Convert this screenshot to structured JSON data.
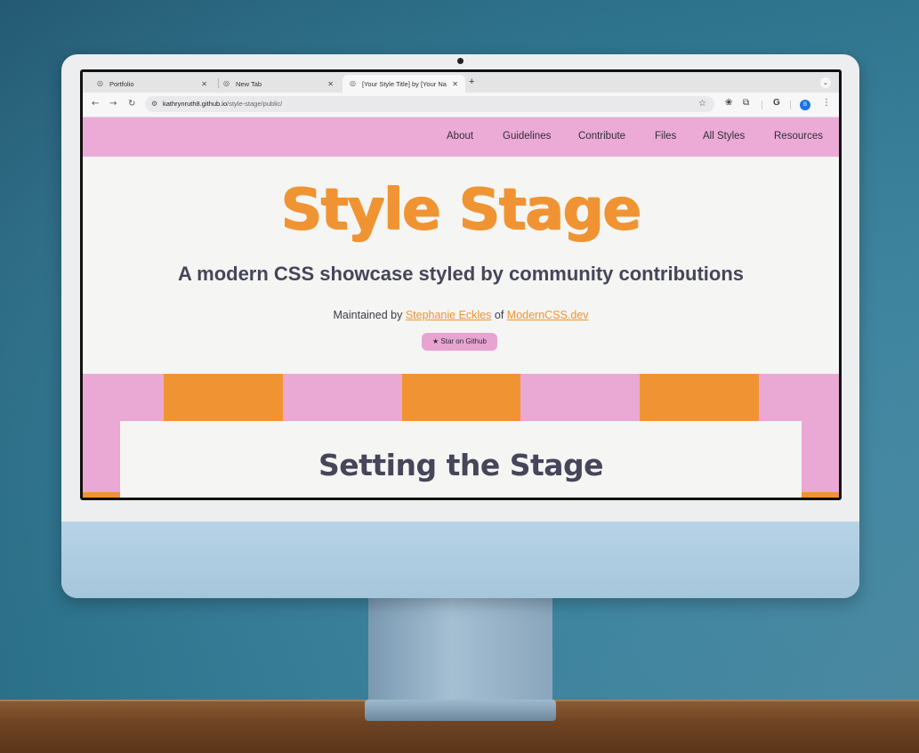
{
  "browser": {
    "tabs": [
      {
        "label": "Portfolio",
        "close": "✕"
      },
      {
        "label": "New Tab",
        "close": "✕"
      },
      {
        "label": "[Your Style Title] by [Your Na",
        "close": "✕"
      }
    ],
    "new_tab": "+",
    "tab_menu": "⌄",
    "nav": {
      "back": "←",
      "forward": "→",
      "reload": "↻"
    },
    "url_host": "kathrynruth8.github.io",
    "url_path": "/style-stage/public/",
    "star": "☆",
    "avatar_initial": "B",
    "google": "G",
    "menu": "⋮"
  },
  "site": {
    "nav": [
      "About",
      "Guidelines",
      "Contribute",
      "Files",
      "All Styles",
      "Resources"
    ],
    "title": "Style Stage",
    "subtitle": "A modern CSS showcase styled by community contributions",
    "maintained_prefix": "Maintained by ",
    "maintainer": "Stephanie Eckles",
    "of": " of ",
    "site_link": "ModernCSS.dev",
    "github_button": "★ Star on Github",
    "section_title": "Setting the Stage"
  },
  "colors": {
    "pink": "#ecaad6",
    "orange": "#f09433",
    "ink": "#45465a",
    "bg": "#f5f5f3"
  }
}
